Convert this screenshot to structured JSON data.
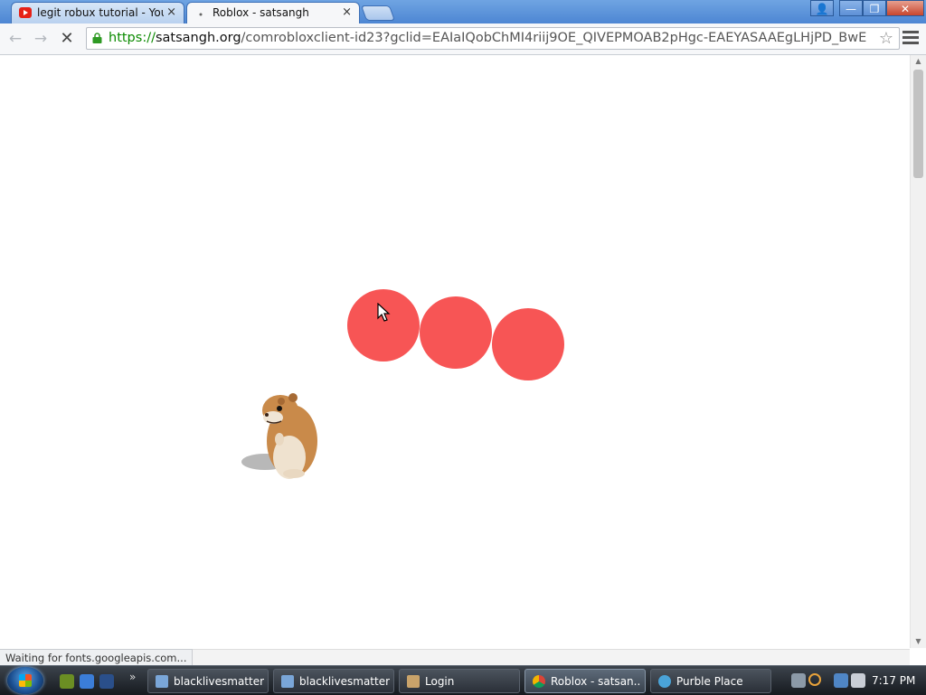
{
  "browser": {
    "tabs": [
      {
        "title": "legit robux tutorial - YouT",
        "favicon": "youtube-icon",
        "active": false
      },
      {
        "title": "Roblox - satsangh",
        "favicon": "loading-icon",
        "active": true
      }
    ],
    "close_glyph": "×",
    "window_buttons": {
      "user": "👤",
      "minimize": "—",
      "maximize": "❐",
      "close": "✕"
    },
    "nav": {
      "back": "←",
      "forward": "→",
      "stop": "✕"
    },
    "url": {
      "scheme": "https://",
      "host": "satsangh.org",
      "path": "/comrobloxclient-id23?gclid=EAIaIQobChMI4riij9OE_QIVEPMOAB2pHgc-EAEYASAAEgLHjPD_BwE"
    },
    "star": "☆",
    "status_text": "Waiting for fonts.googleapis.com..."
  },
  "page": {
    "circles_color": "#f75555",
    "circle_count": 3
  },
  "taskbar": {
    "chevron": "»",
    "tasks": [
      {
        "label": "blacklivesmatter...",
        "icon": "document-icon"
      },
      {
        "label": "blacklivesmatter...",
        "icon": "document-icon"
      },
      {
        "label": "Login",
        "icon": "app-icon"
      },
      {
        "label": "Roblox - satsan...",
        "icon": "chrome-icon",
        "active": true
      },
      {
        "label": "Purble Place",
        "icon": "game-icon"
      }
    ],
    "clock": "7:17 PM"
  },
  "colors": {
    "accent": "#4d86d3",
    "url_green": "#0b8a00",
    "circle": "#f75555"
  }
}
